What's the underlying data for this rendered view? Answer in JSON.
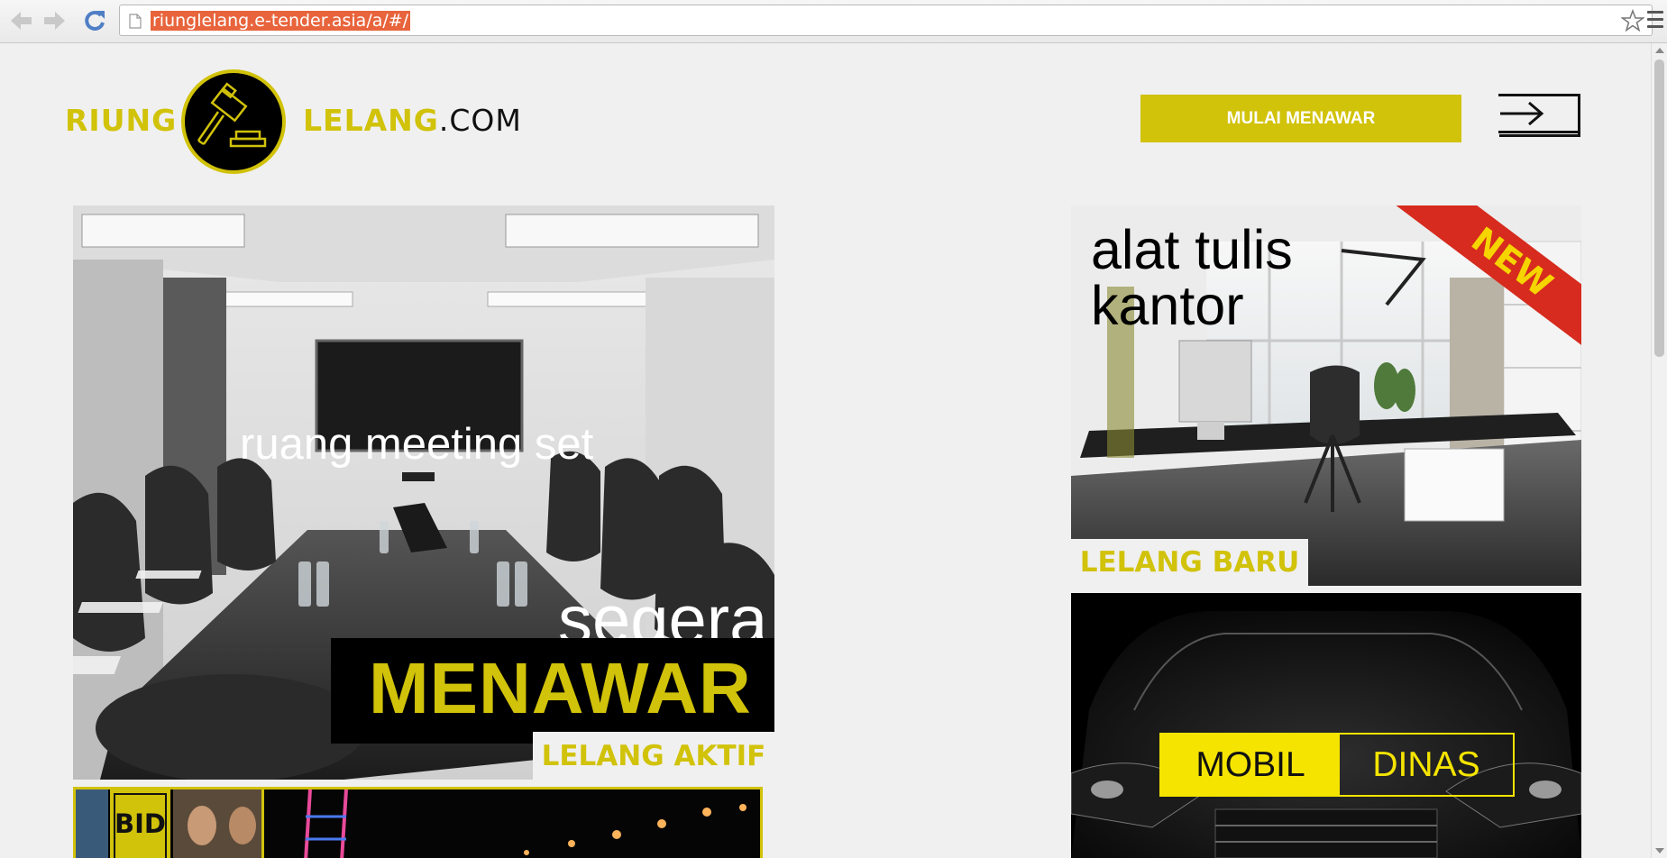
{
  "browser": {
    "url": "riunglelang.e-tender.asia/a/#/"
  },
  "logo": {
    "left": "RIUNG",
    "right_colored": "LELANG",
    "right_plain": ".COM"
  },
  "header": {
    "cta_label": "MULAI MENAWAR"
  },
  "tiles": {
    "meeting": {
      "title": "ruang meeting set",
      "segera": "segera",
      "menawar": "MENAWAR",
      "badge": "LELANG AKTIF"
    },
    "office": {
      "title_line1": "alat tulis",
      "title_line2": "kantor",
      "ribbon": "NEW",
      "badge": "LELANG BARU"
    },
    "car": {
      "label_left": "MOBIL",
      "label_right": "DINAS"
    },
    "bid": {
      "label": "BID"
    }
  },
  "colors": {
    "brand_yellow": "#d1c20a",
    "car_yellow": "#f5e400",
    "ribbon_red": "#d62b1e",
    "url_highlight": "#e8643c"
  },
  "icons": [
    "back-arrow-icon",
    "forward-arrow-icon",
    "reload-icon",
    "page-icon",
    "star-icon",
    "menu-icon",
    "gavel-icon",
    "login-arrow-icon"
  ]
}
